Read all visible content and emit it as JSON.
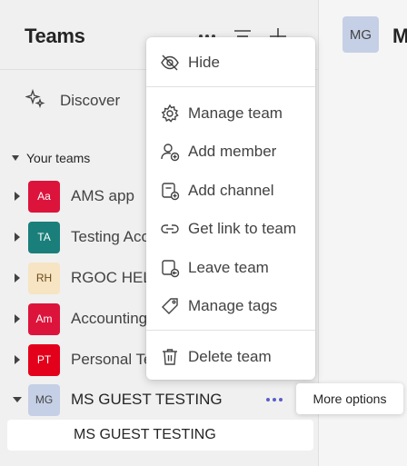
{
  "header": {
    "title": "Teams"
  },
  "discover": {
    "label": "Discover"
  },
  "section": {
    "label": "Your teams"
  },
  "teams": [
    {
      "initials": "Aa",
      "name": "AMS app",
      "color": "#dc143c",
      "text_color": "#ffffff"
    },
    {
      "initials": "TA",
      "name": "Testing Acc",
      "color": "#1a7f7a",
      "text_color": "#ffffff"
    },
    {
      "initials": "RH",
      "name": "RGOC HELI",
      "color": "#f6e4c3",
      "text_color": "#6b4a1a"
    },
    {
      "initials": "Am",
      "name": "Accounting",
      "color": "#dc143c",
      "text_color": "#ffffff"
    },
    {
      "initials": "PT",
      "name": "Personal Te",
      "color": "#e3001b",
      "text_color": "#ffffff"
    },
    {
      "initials": "MG",
      "name": "MS GUEST TESTING",
      "color": "#c5d0e6",
      "text_color": "#444444"
    }
  ],
  "channel": {
    "name": "MS GUEST TESTING"
  },
  "right": {
    "avatar": "MG",
    "initial": "M"
  },
  "menu": {
    "hide": "Hide",
    "manage_team": "Manage team",
    "add_member": "Add member",
    "add_channel": "Add channel",
    "get_link": "Get link to team",
    "leave_team": "Leave team",
    "manage_tags": "Manage tags",
    "delete_team": "Delete team"
  },
  "tooltip": {
    "label": "More options"
  },
  "colors": {
    "accent": "#5b5fc7",
    "sidebar_bg": "#f0f0f0"
  }
}
